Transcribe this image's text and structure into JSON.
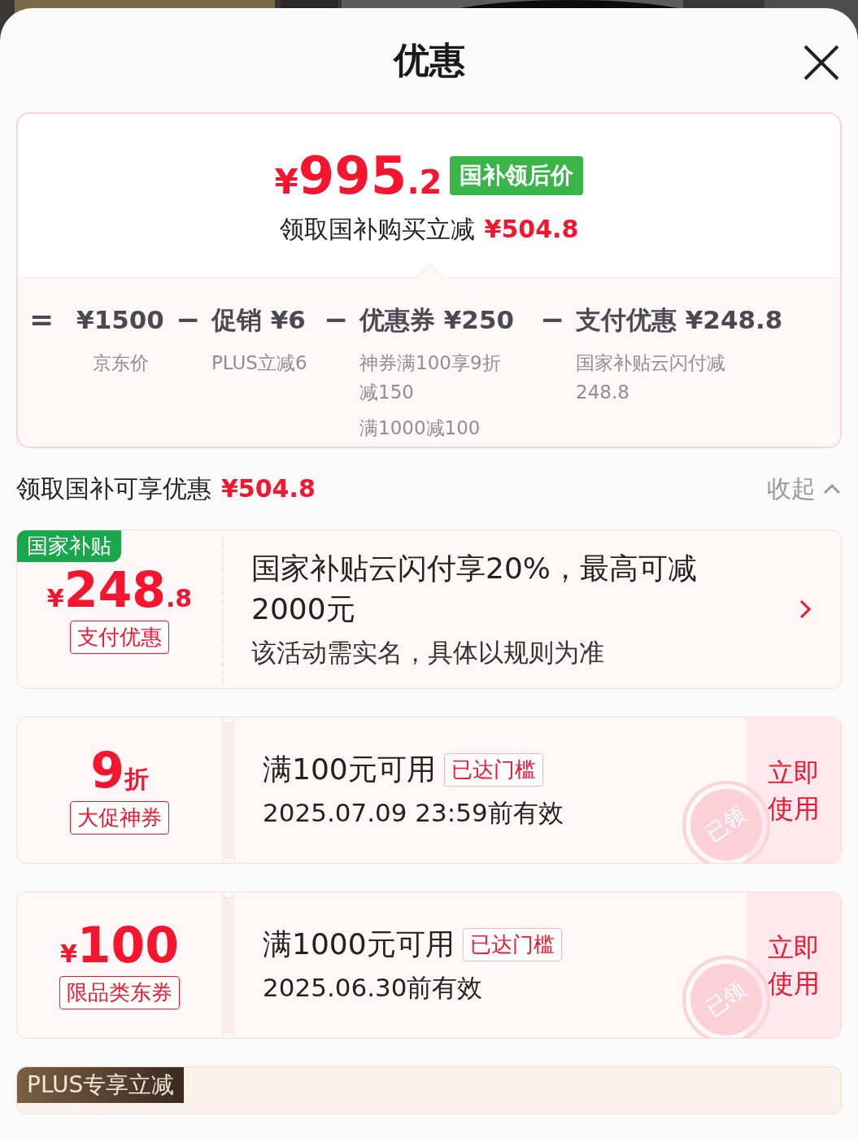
{
  "header": {
    "title": "优惠"
  },
  "summary": {
    "price": {
      "currency": "¥",
      "integer": "995",
      "decimal": ".2"
    },
    "badge": "国补领后价",
    "caption": "领取国补购买立减",
    "caption_amount": "¥504.8",
    "breakdown": [
      {
        "op": "=",
        "value": "¥1500",
        "notes": [
          "京东价"
        ]
      },
      {
        "op": "−",
        "value": "促销 ¥6",
        "notes": [
          "PLUS立减6"
        ]
      },
      {
        "op": "−",
        "value": "优惠券 ¥250",
        "notes": [
          "神券满100享9折减150",
          "满1000减100"
        ]
      },
      {
        "op": "−",
        "value": "支付优惠 ¥248.8",
        "notes": [
          "国家补贴云闪付减248.8"
        ]
      }
    ]
  },
  "section": {
    "title": "领取国补可享优惠",
    "amount": "¥504.8",
    "toggle": "收起",
    "expanded": true
  },
  "offers": [
    {
      "kind": "subsidy",
      "tag": "国家补贴",
      "value": {
        "prefix": "¥",
        "main": "248",
        "suffix": ".8"
      },
      "chip": "支付优惠",
      "title": "国家补贴云闪付享20%，最高可减2000元",
      "subtitle": "该活动需实名，具体以规则为准"
    },
    {
      "kind": "coupon",
      "value": {
        "main": "9",
        "suffix": "折"
      },
      "chip": "大促神券",
      "title": "满100元可用",
      "threshold": "已达门槛",
      "validity": "2025.07.09 23:59前有效",
      "claimed": true,
      "stamp": "已领",
      "action": "立即使用"
    },
    {
      "kind": "coupon",
      "value": {
        "prefix": "¥",
        "main": "100"
      },
      "chip": "限品类东券",
      "title": "满1000元可用",
      "threshold": "已达门槛",
      "validity": "2025.06.30前有效",
      "claimed": true,
      "stamp": "已领",
      "action": "立即使用"
    },
    {
      "kind": "plus",
      "tag": "PLUS专享立减"
    }
  ]
}
